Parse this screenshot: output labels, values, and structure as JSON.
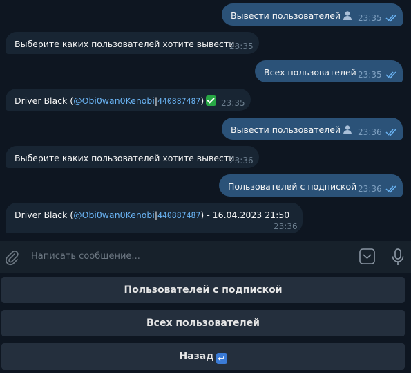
{
  "messages": [
    {
      "dir": "out",
      "text": "Вывести пользователей",
      "time": "23:35"
    },
    {
      "dir": "in",
      "text": "Выберите каких пользователей хотите вывести.",
      "time": "23:35"
    },
    {
      "dir": "out",
      "text": "Всех пользователей",
      "time": "23:35"
    },
    {
      "dir": "in",
      "name": "Driver Black (",
      "mention": "@Obi0wan0Kenobi",
      "sep": "|",
      "id": "440887487",
      "close": ")",
      "time": "23:35"
    },
    {
      "dir": "out",
      "text": "Вывести пользователей",
      "time": "23:36"
    },
    {
      "dir": "in",
      "text": "Выберите каких пользователей хотите вывести.",
      "time": "23:36"
    },
    {
      "dir": "out",
      "text": "Пользователей с подпиской",
      "time": "23:36"
    },
    {
      "dir": "in",
      "name": "Driver Black (",
      "mention": "@Obi0wan0Kenobi",
      "sep": "|",
      "id": "440887487",
      "close": ") - 16.04.2023 21:50",
      "time": "23:36"
    }
  ],
  "composer": {
    "placeholder": "Написать сообщение..."
  },
  "keyboard": [
    {
      "label": "Пользователей с подпиской"
    },
    {
      "label": "Всех пользователей"
    },
    {
      "label": "Назад"
    }
  ],
  "colors": {
    "bg": "#0e1621",
    "outgoing": "#2b5278",
    "incoming": "#182533",
    "accent": "#6ab3f3"
  }
}
